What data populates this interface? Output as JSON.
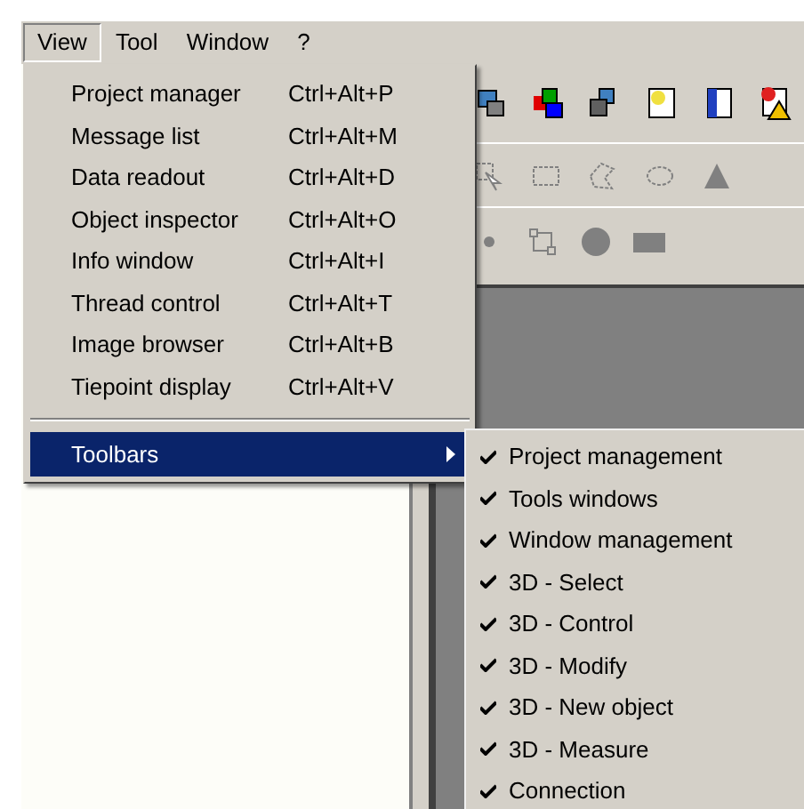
{
  "menubar": [
    {
      "label": "View",
      "selected": true
    },
    {
      "label": "Tool",
      "selected": false
    },
    {
      "label": "Window",
      "selected": false
    },
    {
      "label": "?",
      "selected": false
    }
  ],
  "view_menu": [
    {
      "kind": "command",
      "label": "Project manager",
      "shortcut": "Ctrl+Alt+P"
    },
    {
      "kind": "command",
      "label": "Message list",
      "shortcut": "Ctrl+Alt+M"
    },
    {
      "kind": "command",
      "label": "Data readout",
      "shortcut": "Ctrl+Alt+D"
    },
    {
      "kind": "command",
      "label": "Object inspector",
      "shortcut": "Ctrl+Alt+O"
    },
    {
      "kind": "command",
      "label": "Info window",
      "shortcut": "Ctrl+Alt+I"
    },
    {
      "kind": "command",
      "label": "Thread control",
      "shortcut": "Ctrl+Alt+T"
    },
    {
      "kind": "command",
      "label": "Image browser",
      "shortcut": "Ctrl+Alt+B"
    },
    {
      "kind": "command",
      "label": "Tiepoint display",
      "shortcut": "Ctrl+Alt+V"
    },
    {
      "kind": "separator"
    },
    {
      "kind": "submenu",
      "label": "Toolbars",
      "selected": true
    }
  ],
  "toolbars_submenu": [
    {
      "label": "Project management",
      "checked": true
    },
    {
      "label": "Tools windows",
      "checked": true
    },
    {
      "label": "Window management",
      "checked": true
    },
    {
      "label": "3D - Select",
      "checked": true
    },
    {
      "label": "3D - Control",
      "checked": true
    },
    {
      "label": "3D - Modify",
      "checked": true
    },
    {
      "label": "3D - New object",
      "checked": true
    },
    {
      "label": "3D - Measure",
      "checked": true
    },
    {
      "label": "Connection",
      "checked": true
    }
  ]
}
